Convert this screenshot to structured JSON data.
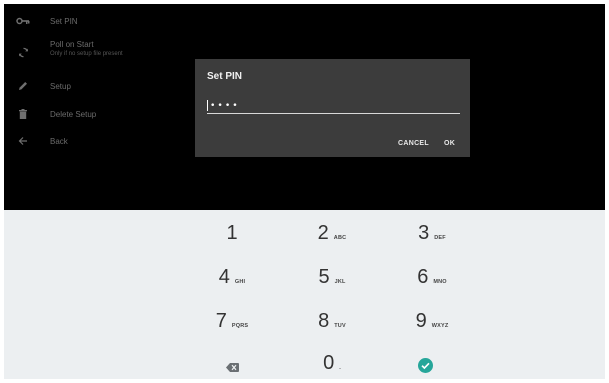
{
  "menu": {
    "items": [
      {
        "label": "Set PIN",
        "icon": "key-icon"
      },
      {
        "label": "Poll on Start",
        "sublabel": "Only if no setup file present",
        "icon": "sync-icon"
      },
      {
        "label": "Setup",
        "icon": "pencil-icon"
      },
      {
        "label": "Delete Setup",
        "icon": "trash-icon"
      },
      {
        "label": "Back",
        "icon": "arrow-left-icon"
      }
    ]
  },
  "dialog": {
    "title": "Set PIN",
    "pin_value": "••••",
    "cancel_label": "CANCEL",
    "ok_label": "OK"
  },
  "keypad": {
    "keys": [
      {
        "digit": "1",
        "letters": ""
      },
      {
        "digit": "2",
        "letters": "ABC"
      },
      {
        "digit": "3",
        "letters": "DEF"
      },
      {
        "digit": "4",
        "letters": "GHI"
      },
      {
        "digit": "5",
        "letters": "JKL"
      },
      {
        "digit": "6",
        "letters": "MNO"
      },
      {
        "digit": "7",
        "letters": "PQRS"
      },
      {
        "digit": "8",
        "letters": "TUV"
      },
      {
        "digit": "9",
        "letters": "WXYZ"
      },
      {
        "digit": "0",
        "letters": "."
      }
    ],
    "accent_color": "#26a69a",
    "backspace_icon": "backspace-icon",
    "done_icon": "check-circle-icon"
  }
}
